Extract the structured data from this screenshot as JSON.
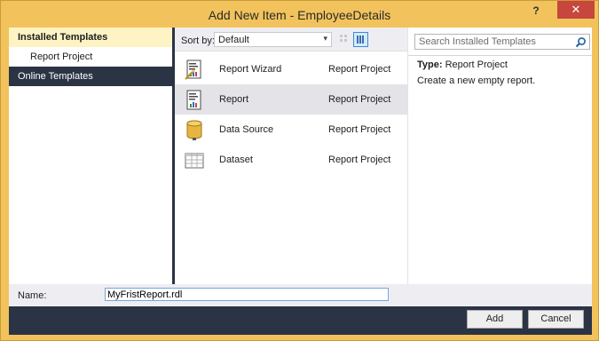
{
  "window": {
    "title": "Add New Item - EmployeeDetails",
    "help_label": "?",
    "close_label": "✕"
  },
  "left_pane": {
    "header": "Installed Templates",
    "items": [
      "Report Project"
    ],
    "online": "Online Templates"
  },
  "toolbar": {
    "sort_label": "Sort by:",
    "sort_value": "Default"
  },
  "templates": [
    {
      "name": "Report Wizard",
      "type": "Report Project",
      "icon": "report-wizard-icon"
    },
    {
      "name": "Report",
      "type": "Report Project",
      "icon": "report-icon",
      "selected": true
    },
    {
      "name": "Data Source",
      "type": "Report Project",
      "icon": "data-source-icon"
    },
    {
      "name": "Dataset",
      "type": "Report Project",
      "icon": "dataset-icon"
    }
  ],
  "details": {
    "search_placeholder": "Search Installed Templates",
    "type_label": "Type:",
    "type_value": "Report Project",
    "description": "Create a new empty report."
  },
  "name_row": {
    "label": "Name:",
    "value": "MyFristReport.rdl"
  },
  "buttons": {
    "add": "Add",
    "cancel": "Cancel"
  },
  "colors": {
    "accent": "#f2c35c",
    "navy": "#2b3445",
    "selection": "#e3e3e8",
    "close": "#c7463d"
  }
}
